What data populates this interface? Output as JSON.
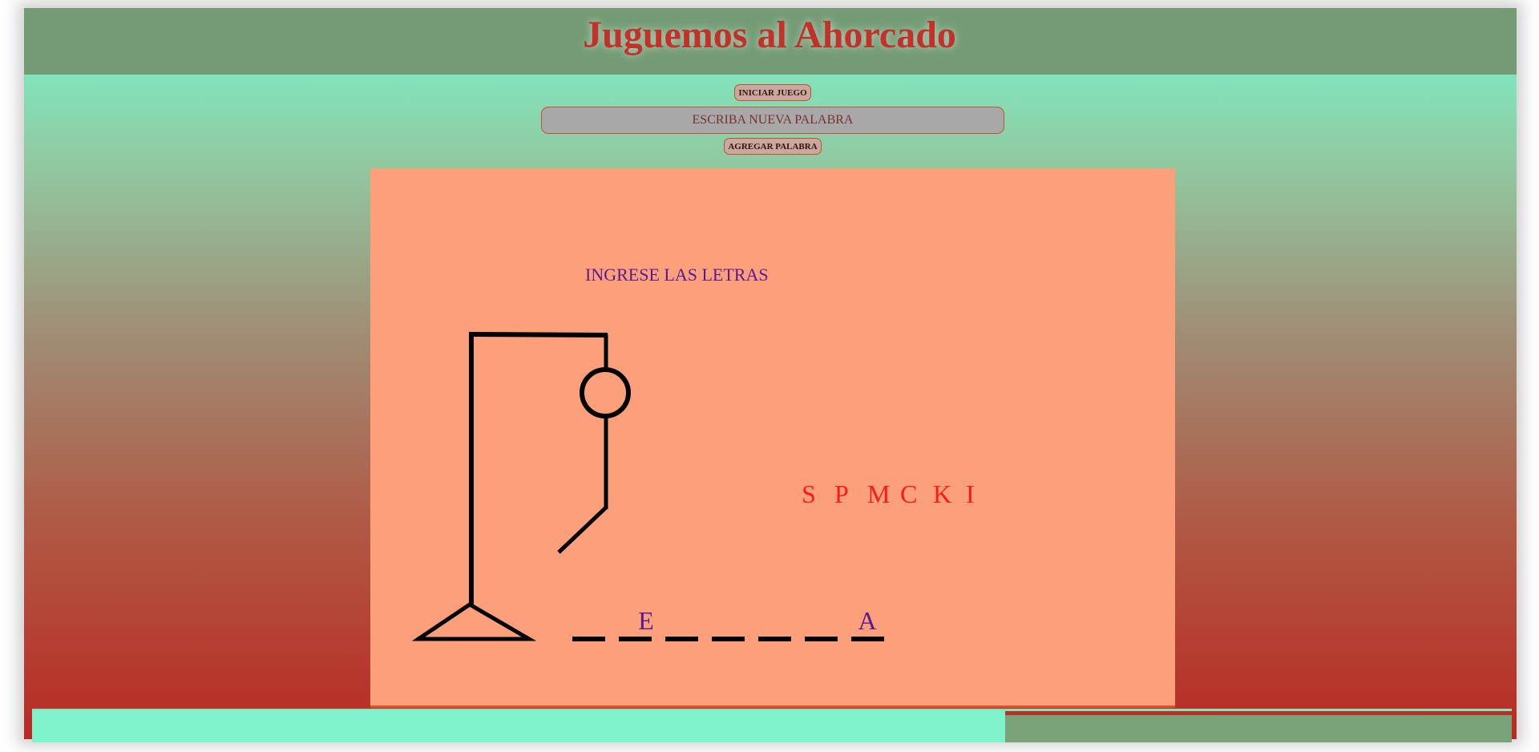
{
  "header": {
    "title": "Juguemos al Ahorcado"
  },
  "controls": {
    "start_button_label": "INICIAR JUEGO",
    "word_input_placeholder": "ESCRIBA NUEVA PALABRA",
    "word_input_value": "",
    "add_button_label": "AGREGAR PALABRA"
  },
  "board": {
    "prompt": "INGRESE LAS LETRAS",
    "wrong_letters": [
      "S",
      "P",
      "M",
      "C",
      "K",
      "I"
    ],
    "word_slots": [
      "",
      "E",
      "",
      "",
      "",
      "",
      "A"
    ],
    "hangman_parts_visible": [
      "head",
      "body",
      "left-arm"
    ]
  },
  "colors": {
    "title": "#c1322a",
    "header": "#739c74",
    "board": "#fca07c",
    "prompt": "#5a1a8f",
    "wrong_letters": "#ff1a1a",
    "correct_letters": "#5a1a8f"
  }
}
